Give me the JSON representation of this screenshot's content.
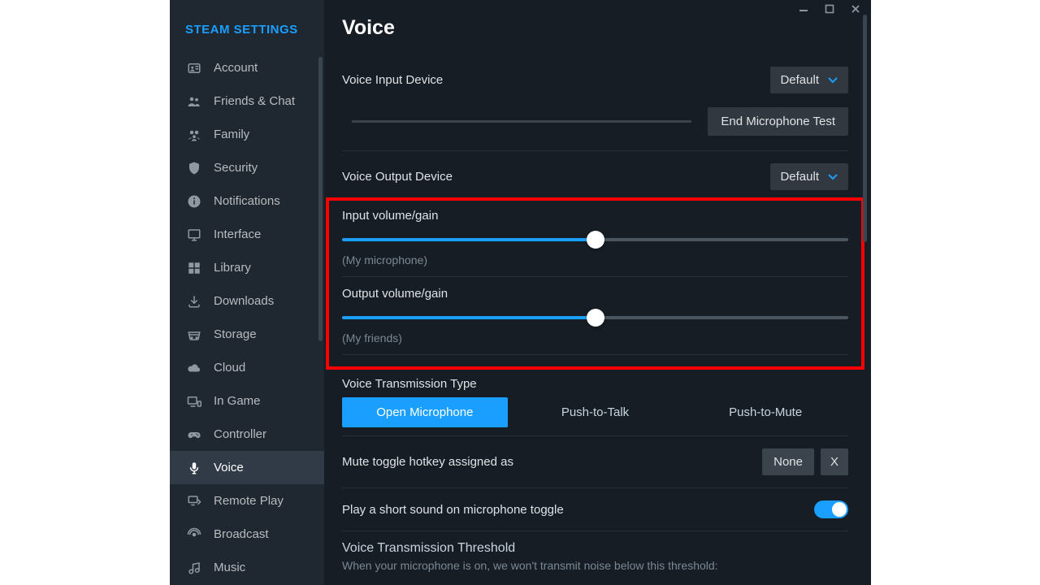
{
  "titlebar": {
    "min": "—",
    "max": "▢",
    "close": "✕"
  },
  "sidebar": {
    "title": "STEAM SETTINGS",
    "items": [
      {
        "label": "Account"
      },
      {
        "label": "Friends & Chat"
      },
      {
        "label": "Family"
      },
      {
        "label": "Security"
      },
      {
        "label": "Notifications"
      },
      {
        "label": "Interface"
      },
      {
        "label": "Library"
      },
      {
        "label": "Downloads"
      },
      {
        "label": "Storage"
      },
      {
        "label": "Cloud"
      },
      {
        "label": "In Game"
      },
      {
        "label": "Controller"
      },
      {
        "label": "Voice"
      },
      {
        "label": "Remote Play"
      },
      {
        "label": "Broadcast"
      },
      {
        "label": "Music"
      }
    ],
    "active_index": 12
  },
  "content": {
    "title": "Voice",
    "input_device": {
      "label": "Voice Input Device",
      "value": "Default"
    },
    "mic_test_button": "End Microphone Test",
    "output_device": {
      "label": "Voice Output Device",
      "value": "Default"
    },
    "input_gain": {
      "label": "Input volume/gain",
      "value_pct": 50,
      "subtext": "(My microphone)"
    },
    "output_gain": {
      "label": "Output volume/gain",
      "value_pct": 50,
      "subtext": "(My friends)"
    },
    "trans_type": {
      "label": "Voice Transmission Type",
      "options": [
        "Open Microphone",
        "Push-to-Talk",
        "Push-to-Mute"
      ],
      "active_index": 0
    },
    "mute_hotkey": {
      "label": "Mute toggle hotkey assigned as",
      "value": "None",
      "clear": "X"
    },
    "sound_toggle": {
      "label": "Play a short sound on microphone toggle",
      "on": true
    },
    "threshold": {
      "label": "Voice Transmission Threshold",
      "desc": "When your microphone is on, we won't transmit noise below this threshold:"
    }
  }
}
